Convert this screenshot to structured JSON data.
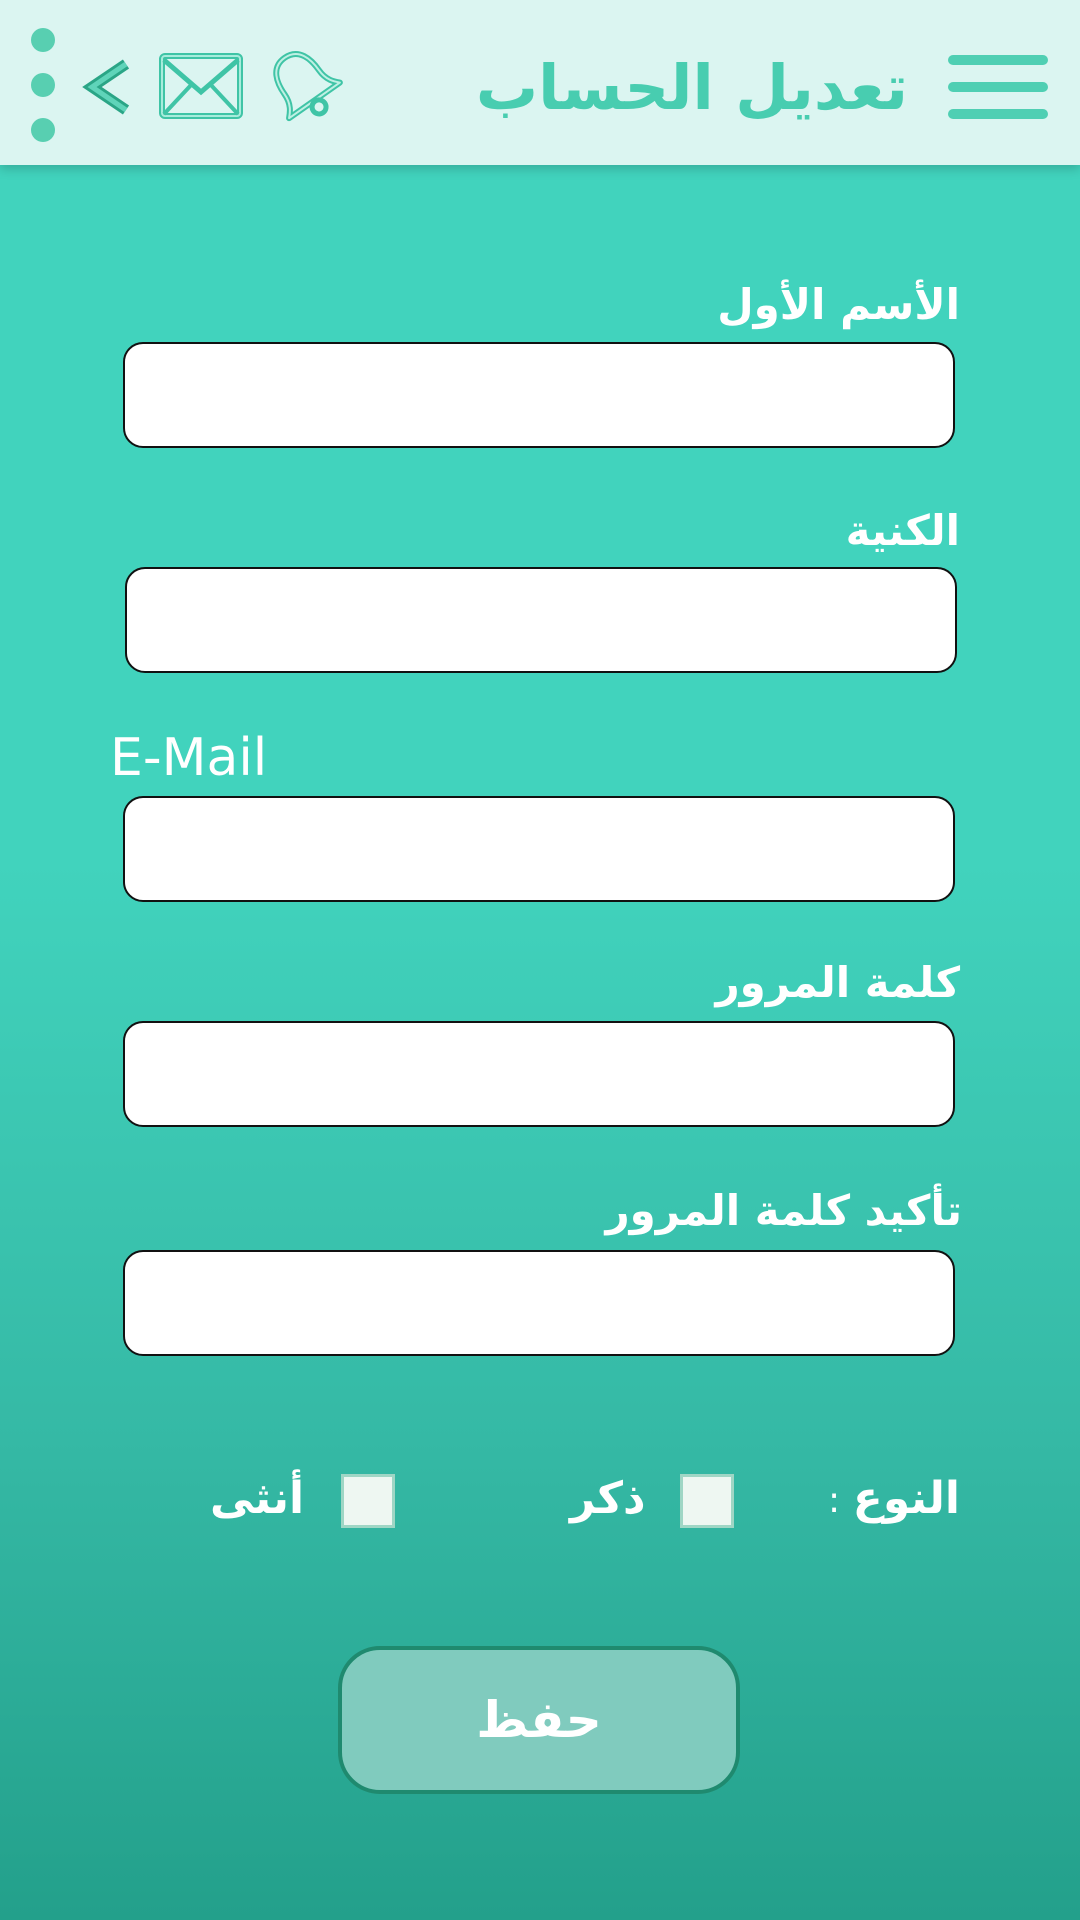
{
  "header": {
    "title": "تعديل الحساب",
    "icons": [
      "hamburger-menu-icon",
      "more-vertical-icon",
      "back-arrow-icon",
      "mail-icon",
      "bell-icon"
    ]
  },
  "form": {
    "first_name": {
      "label": "الأسم الأول",
      "value": ""
    },
    "last_name": {
      "label": "الكنية",
      "value": ""
    },
    "email": {
      "label": "E-Mail",
      "value": ""
    },
    "password": {
      "label": "كلمة المرور",
      "value": ""
    },
    "confirm_password": {
      "label": "تأكيد كلمة المرور",
      "value": ""
    },
    "gender": {
      "label": "النوع",
      "separator": ":",
      "male_label": "ذكر",
      "female_label": "أنثى",
      "male_checked": false,
      "female_checked": false
    },
    "save_label": "حفظ"
  },
  "colors": {
    "accent": "#48cdb0",
    "header_bg": "#dbf5f1",
    "background_top": "#41d3bd",
    "background_bottom": "#23a08b",
    "button_bg": "#80cbbe",
    "button_border": "#1f8a6f"
  }
}
